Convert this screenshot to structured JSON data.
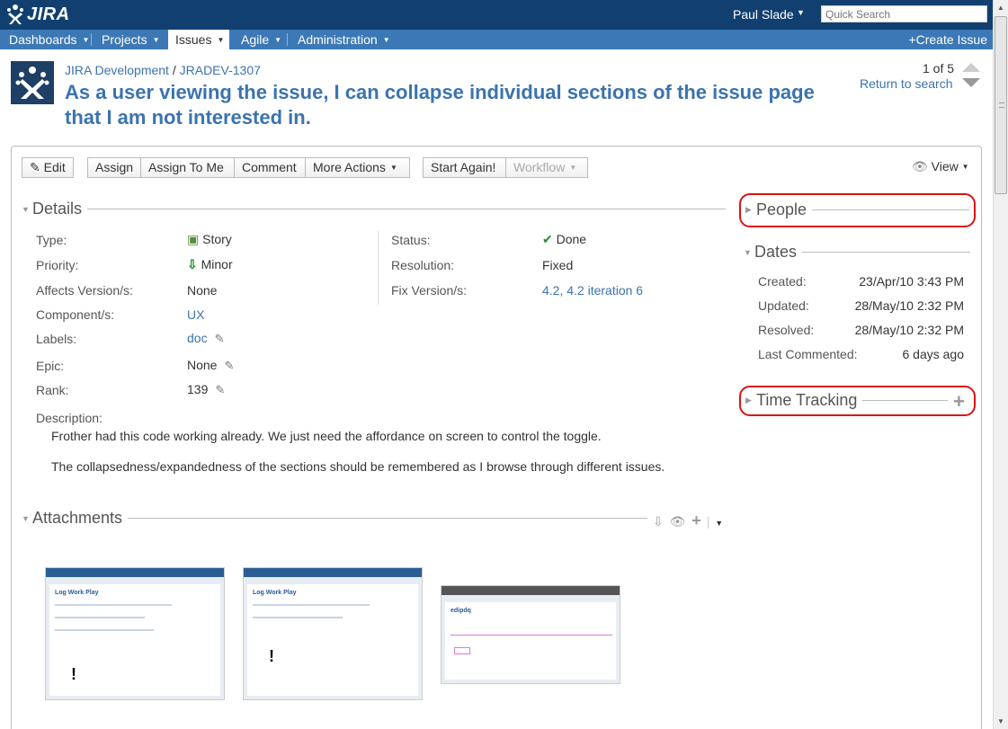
{
  "header": {
    "logo_text": "JIRA",
    "user_name": "Paul Slade",
    "search_placeholder": "Quick Search"
  },
  "nav": {
    "items": [
      {
        "label": "Dashboards"
      },
      {
        "label": "Projects"
      },
      {
        "label": "Issues"
      },
      {
        "label": "Agile"
      },
      {
        "label": "Administration"
      }
    ],
    "active": "Issues",
    "create_issue": "Create Issue"
  },
  "issue": {
    "project": "JIRA Development",
    "separator": "/",
    "key": "JRADEV-1307",
    "title": "As a user viewing the issue, I can collapse individual sections of the issue page that I am not interested in.",
    "pager": "1 of 5",
    "return_to_search": "Return to search"
  },
  "toolbar": {
    "edit": "Edit",
    "assign": "Assign",
    "assign_to_me": "Assign To Me",
    "comment": "Comment",
    "more_actions": "More Actions",
    "start_again": "Start Again!",
    "workflow": "Workflow",
    "view": "View"
  },
  "details": {
    "heading": "Details",
    "type_label": "Type:",
    "type_value": "Story",
    "priority_label": "Priority:",
    "priority_value": "Minor",
    "affects_label": "Affects Version/s:",
    "affects_value": "None",
    "component_label": "Component/s:",
    "component_value": "UX",
    "labels_label": "Labels:",
    "labels_value": "doc",
    "epic_label": "Epic:",
    "epic_value": "None",
    "rank_label": "Rank:",
    "rank_value": "139",
    "status_label": "Status:",
    "status_value": "Done",
    "resolution_label": "Resolution:",
    "resolution_value": "Fixed",
    "fix_label": "Fix Version/s:",
    "fix_value": "4.2, 4.2 iteration 6",
    "description_label": "Description:",
    "description_p1": "Frother had this code working already. We just need the affordance on screen to control the toggle.",
    "description_p2": "The collapsedness/expandedness of the sections should be remembered as I browse through different issues."
  },
  "people": {
    "heading": "People"
  },
  "dates": {
    "heading": "Dates",
    "created_label": "Created:",
    "created_value": "23/Apr/10 3:43 PM",
    "updated_label": "Updated:",
    "updated_value": "28/May/10 2:32 PM",
    "resolved_label": "Resolved:",
    "resolved_value": "28/May/10 2:32 PM",
    "commented_label": "Last Commented:",
    "commented_value": "6 days ago"
  },
  "time_tracking": {
    "heading": "Time Tracking"
  },
  "attachments": {
    "heading": "Attachments",
    "thumbnails": [
      {
        "title": "Log Work Play",
        "mark": "!"
      },
      {
        "title": "Log Work Play",
        "mark": "!"
      },
      {
        "title": "edipdq",
        "mark": ""
      }
    ]
  },
  "colors": {
    "header_bg": "#114070",
    "nav_bg": "#3c78b5",
    "link": "#3b73af",
    "highlight": "#d11111"
  }
}
